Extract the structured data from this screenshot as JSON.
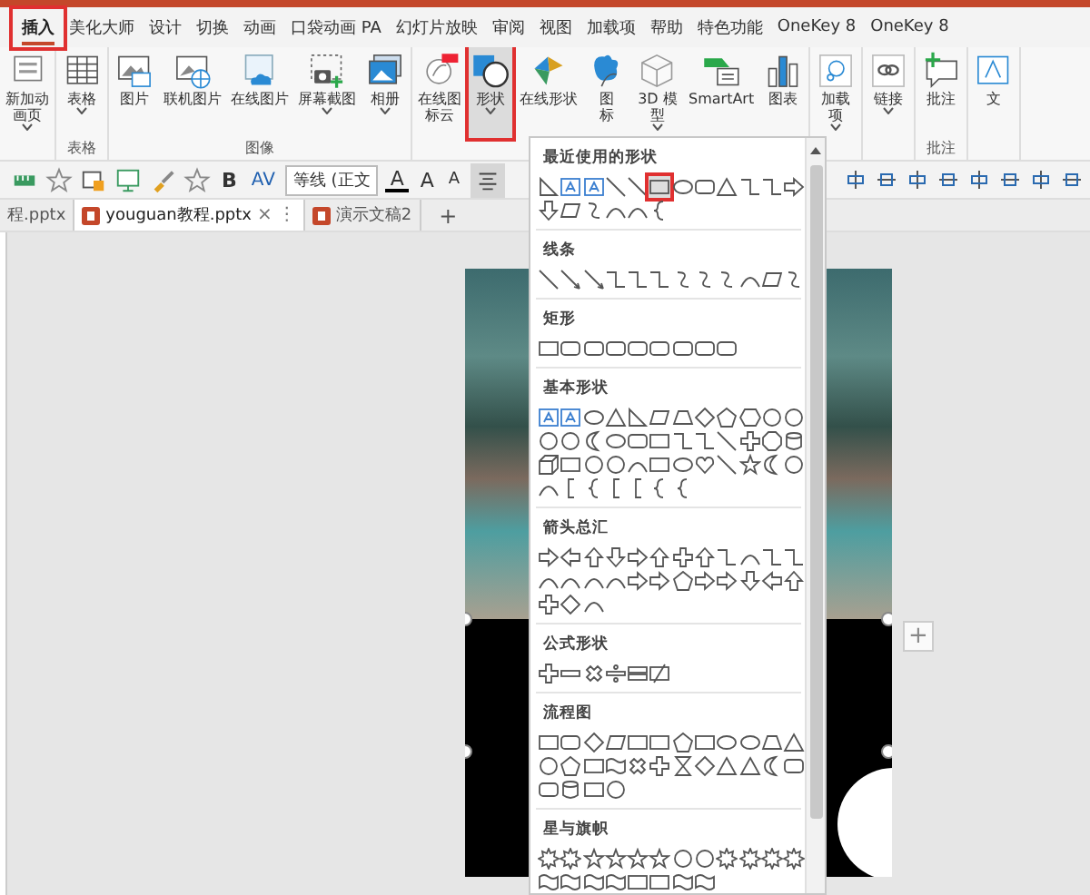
{
  "ribbon_tabs": [
    {
      "label": "插入",
      "selected": true
    },
    {
      "label": "美化大师",
      "selected": false
    },
    {
      "label": "设计",
      "selected": false
    },
    {
      "label": "切换",
      "selected": false
    },
    {
      "label": "动画",
      "selected": false
    },
    {
      "label": "口袋动画 PA",
      "selected": false
    },
    {
      "label": "幻灯片放映",
      "selected": false
    },
    {
      "label": "审阅",
      "selected": false
    },
    {
      "label": "视图",
      "selected": false
    },
    {
      "label": "加载项",
      "selected": false
    },
    {
      "label": "帮助",
      "selected": false
    },
    {
      "label": "特色功能",
      "selected": false
    },
    {
      "label": "OneKey 8",
      "selected": false
    },
    {
      "label": "OneKey 8",
      "selected": false
    }
  ],
  "ribbon_groups": [
    {
      "buttons": [
        {
          "kind": "new-page",
          "label": "新加动画页",
          "wrap": true,
          "dropdown": true,
          "selected": false
        }
      ]
    },
    {
      "label": "表格",
      "buttons": [
        {
          "kind": "table",
          "label": "表格",
          "dropdown": true,
          "selected": false
        }
      ]
    },
    {
      "label": "图像",
      "buttons": [
        {
          "kind": "picture",
          "label": "图片",
          "dropdown": false,
          "selected": false
        },
        {
          "kind": "online-picture",
          "label": "联机图片",
          "dropdown": false,
          "selected": false
        },
        {
          "kind": "cloud-picture",
          "label": "在线图片",
          "dropdown": false,
          "selected": false
        },
        {
          "kind": "screenshot",
          "label": "屏幕截图",
          "dropdown": true,
          "selected": false
        },
        {
          "kind": "album",
          "label": "相册",
          "dropdown": true,
          "selected": false
        }
      ]
    },
    {
      "buttons": [
        {
          "kind": "icon-cloud",
          "label": "在线图标云",
          "wrap": true,
          "dropdown": false,
          "selected": false
        },
        {
          "kind": "shapes",
          "label": "形状",
          "dropdown": true,
          "selected": true
        },
        {
          "kind": "online-shapes",
          "label": "在线形状",
          "dropdown": false,
          "selected": false
        },
        {
          "kind": "icons",
          "label": "图标",
          "wrap": true,
          "dropdown": false,
          "selected": false
        },
        {
          "kind": "model",
          "label": "3D 模型",
          "wrap": true,
          "dropdown": true,
          "selected": false
        },
        {
          "kind": "smartart",
          "label": "SmartArt",
          "dropdown": false,
          "selected": false
        },
        {
          "kind": "chart",
          "label": "图表",
          "dropdown": false,
          "selected": false
        }
      ]
    },
    {
      "buttons": [
        {
          "kind": "addin",
          "label": "加载项",
          "wrap": true,
          "dropdown": true,
          "selected": false
        }
      ]
    },
    {
      "buttons": [
        {
          "kind": "link",
          "label": "链接",
          "dropdown": true,
          "selected": false
        }
      ]
    },
    {
      "label": "批注",
      "buttons": [
        {
          "kind": "comment",
          "label": "批注",
          "dropdown": false,
          "selected": false
        }
      ]
    },
    {
      "buttons": [
        {
          "kind": "text",
          "label": "文",
          "dropdown": false,
          "selected": false
        }
      ]
    }
  ],
  "format_toolbar": [
    {
      "kind": "ruler"
    },
    {
      "kind": "star"
    },
    {
      "kind": "frame"
    },
    {
      "kind": "monitor"
    },
    {
      "kind": "brush"
    },
    {
      "kind": "star"
    },
    {
      "kind": "bold",
      "text": "B"
    },
    {
      "kind": "spacing",
      "text": "AV"
    },
    {
      "kind": "font",
      "text": "等线 (正文"
    },
    {
      "kind": "color",
      "text": "A"
    },
    {
      "kind": "grow",
      "text": "A"
    },
    {
      "kind": "shrink",
      "text": "A"
    },
    {
      "kind": "align",
      "selected": true
    }
  ],
  "document_tabs": [
    {
      "title": "程.pptx",
      "active": false
    },
    {
      "title": "youguan教程.pptx",
      "active": true,
      "close": "×",
      "more": "⋮"
    },
    {
      "title": "演示文稿2",
      "active": false
    }
  ],
  "new_tab": "+",
  "slide_add": "+",
  "shapes_panel": {
    "sections": [
      {
        "kind": "recent",
        "title": "最近使用的形状",
        "items": [
          {
            "selected": false
          },
          {
            "selected": false
          },
          {
            "selected": false
          },
          {
            "selected": false
          },
          {
            "selected": false
          },
          {
            "selected": true
          },
          {
            "selected": false
          },
          {
            "selected": false
          },
          {
            "selected": false
          },
          {
            "selected": false
          },
          {
            "selected": false
          },
          {
            "selected": false
          },
          {
            "selected": false
          },
          {
            "selected": false
          },
          {
            "selected": false
          },
          {
            "selected": false
          },
          {
            "selected": false
          },
          {
            "selected": false
          }
        ]
      },
      {
        "kind": "lines",
        "title": "线条"
      },
      {
        "kind": "rectangles",
        "title": "矩形"
      },
      {
        "kind": "basic",
        "title": "基本形状"
      },
      {
        "kind": "arrows",
        "title": "箭头总汇"
      },
      {
        "kind": "equation",
        "title": "公式形状"
      },
      {
        "kind": "flowchart",
        "title": "流程图"
      },
      {
        "kind": "stars",
        "title": "星与旗帜"
      }
    ]
  }
}
